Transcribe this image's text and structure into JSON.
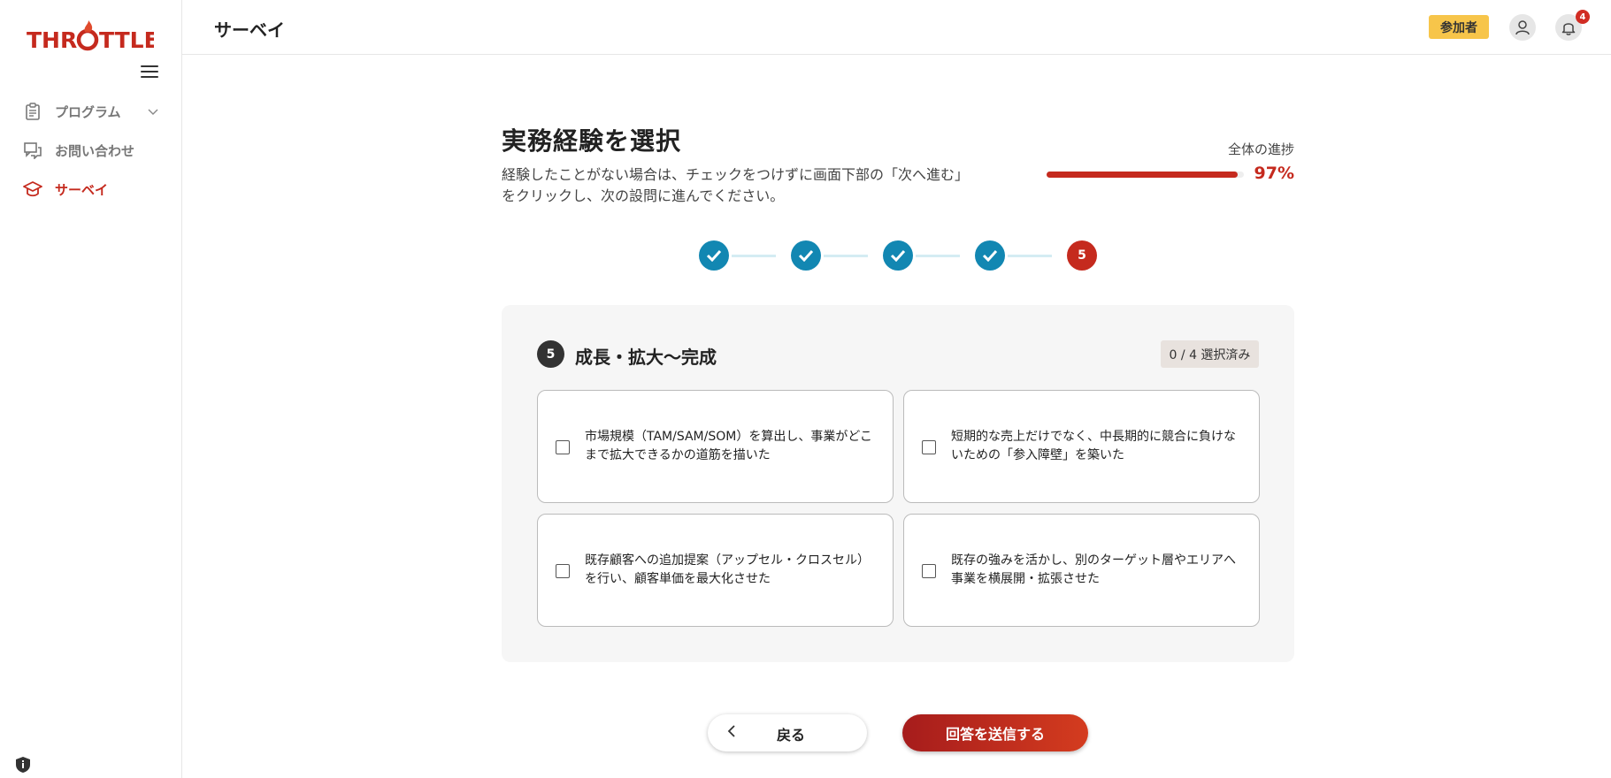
{
  "app": {
    "logo_text_a": "THR",
    "logo_text_b": "TTLE",
    "logo_full": "THROTTLE"
  },
  "sidebar": {
    "items": [
      {
        "label": "プログラム",
        "icon": "clipboard-icon",
        "active": false,
        "has_chevron": true
      },
      {
        "label": "お問い合わせ",
        "icon": "chat-icon",
        "active": false,
        "has_chevron": false
      },
      {
        "label": "サーベイ",
        "icon": "graduation-cap-icon",
        "active": true,
        "has_chevron": false
      }
    ]
  },
  "header": {
    "title": "サーベイ",
    "role_badge": "参加者",
    "notification_count": "4"
  },
  "main": {
    "title": "実務経験を選択",
    "description": "経験したことがない場合は、チェックをつけずに画面下部の「次へ進む」をクリックし、次の設問に進んでください。",
    "progress": {
      "label": "全体の進捗",
      "value": 97,
      "display": "97%"
    },
    "stepper": {
      "completed_steps": 4,
      "current_step": "5",
      "total_steps": 5
    },
    "section": {
      "number": "5",
      "title": "成長・拡大〜完成",
      "selected_count": "0 / 4 選択済み",
      "options": [
        {
          "text": "市場規模（TAM/SAM/SOM）を算出し、事業がどこまで拡大できるかの道筋を描いた",
          "checked": false
        },
        {
          "text": "短期的な売上だけでなく、中長期的に競合に負けないための「参入障壁」を築いた",
          "checked": false
        },
        {
          "text": "既存顧客への追加提案（アップセル・クロスセル）を行い、顧客単価を最大化させた",
          "checked": false
        },
        {
          "text": "既存の強みを活かし、別のターゲット層やエリアへ事業を横展開・拡張させた",
          "checked": false
        }
      ]
    },
    "buttons": {
      "back": "戻る",
      "submit": "回答を送信する"
    }
  },
  "colors": {
    "accent": "#c52a1e",
    "step_done": "#1287b2",
    "badge": "#f7c54a"
  }
}
